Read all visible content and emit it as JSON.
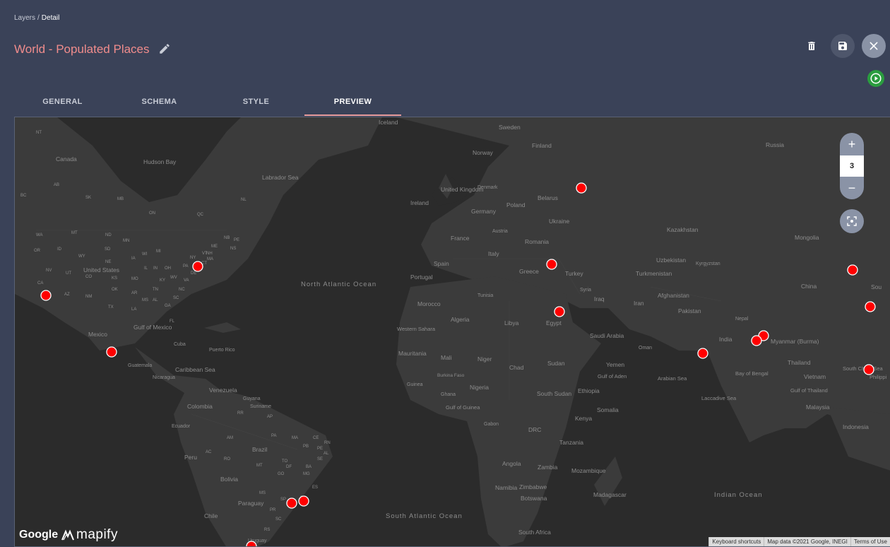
{
  "breadcrumb": {
    "parent": "Layers",
    "separator": "/",
    "current": "Detail"
  },
  "title": "World - Populated Places",
  "tabs": [
    {
      "label": "GENERAL",
      "active": false
    },
    {
      "label": "SCHEMA",
      "active": false
    },
    {
      "label": "STYLE",
      "active": false
    },
    {
      "label": "PREVIEW",
      "active": true
    }
  ],
  "icons": {
    "edit": "pencil-icon",
    "delete": "trash-icon",
    "save": "save-icon",
    "close": "close-icon",
    "run": "play-icon",
    "fit": "fit-bounds-icon"
  },
  "colors": {
    "accent": "#f08c8c",
    "background": "#3a4258",
    "marker": "#ff0000",
    "run": "#2a9d3f",
    "map": "#2b2b2b"
  },
  "map": {
    "zoom_in_label": "+",
    "zoom_level": "3",
    "zoom_out_label": "−",
    "google_logo": "Google",
    "mapify_logo": "mapify",
    "attribution": [
      "Keyboard shortcuts",
      "Map data ©2021 Google, INEGI",
      "Terms of Use"
    ],
    "labels": {
      "iceland": "Iceland",
      "sweden": "Sweden",
      "finland": "Finland",
      "norway": "Norway",
      "russia": "Russia",
      "canada": "Canada",
      "hudson_bay": "Hudson Bay",
      "labrador_sea": "Labrador Sea",
      "united_kingdom": "United Kingdom",
      "denmark": "Denmark",
      "ireland": "Ireland",
      "belarus": "Belarus",
      "germany": "Germany",
      "poland": "Poland",
      "ukraine": "Ukraine",
      "kazakhstan": "Kazakhstan",
      "mongolia": "Mongolia",
      "france": "France",
      "austria": "Austria",
      "romania": "Romania",
      "italy": "Italy",
      "spain": "Spain",
      "portugal": "Portugal",
      "greece": "Greece",
      "turkey": "Turkey",
      "uzbekistan": "Uzbekistan",
      "kyrgyzstan": "Kyrgyzstan",
      "turkmenistan": "Turkmenistan",
      "china": "China",
      "united_states": "United States",
      "north_atlantic_ocean": "North Atlantic Ocean",
      "tunisia": "Tunisia",
      "syria": "Syria",
      "afghanistan": "Afghanistan",
      "iraq": "Iraq",
      "iran": "Iran",
      "morocco": "Morocco",
      "algeria": "Algeria",
      "libya": "Libya",
      "egypt": "Egypt",
      "pakistan": "Pakistan",
      "nepal": "Nepal",
      "gulf_of_mexico": "Gulf of Mexico",
      "mexico": "Mexico",
      "saudi_arabia": "Saudi Arabia",
      "india": "India",
      "myanmar": "Myanmar (Burma)",
      "western_sahara": "Western Sahara",
      "cuba": "Cuba",
      "puerto_rico": "Puerto Rico",
      "oman": "Oman",
      "mauritania": "Mauritania",
      "mali": "Mali",
      "niger": "Niger",
      "guatemala": "Guatemala",
      "caribbean_sea": "Caribbean Sea",
      "chad": "Chad",
      "sudan": "Sudan",
      "yemen": "Yemen",
      "gulf_of_aden": "Gulf of Aden",
      "arabian_sea": "Arabian Sea",
      "bay_of_bengal": "Bay of Bengal",
      "thailand": "Thailand",
      "south_china_sea": "South China Sea",
      "philippines": "Philippi",
      "vietnam": "Vietnam",
      "nicaragua": "Nicaragua",
      "burkina_faso": "Burkina Faso",
      "guinea": "Guinea",
      "ghana": "Ghana",
      "nigeria": "Nigeria",
      "south_sudan": "South Sudan",
      "ethiopia": "Ethiopia",
      "gulf_of_thailand": "Gulf of Thailand",
      "venezuela": "Venezuela",
      "guyana": "Guyana",
      "suriname": "Suriname",
      "laccadive_sea": "Laccadive Sea",
      "colombia": "Colombia",
      "gulf_of_guinea": "Gulf of Guinea",
      "somalia": "Somalia",
      "malaysia": "Malaysia",
      "kenya": "Kenya",
      "gabon": "Gabon",
      "ecuador": "Ecuador",
      "drc": "DRC",
      "indonesia": "Indonesia",
      "brazil": "Brazil",
      "tanzania": "Tanzania",
      "peru": "Peru",
      "angola": "Angola",
      "zambia": "Zambia",
      "mozambique": "Mozambique",
      "bolivia": "Bolivia",
      "namibia": "Namibia",
      "zimbabwe": "Zimbabwe",
      "madagascar": "Madagascar",
      "indian_ocean": "Indian Ocean",
      "botswana": "Botswana",
      "paraguay": "Paraguay",
      "chile": "Chile",
      "south_atlantic_ocean": "South Atlantic Ocean",
      "south_africa": "South Africa",
      "uruguay": "Uruguay",
      "sou": "Sou"
    },
    "state_codes": [
      "NT",
      "AB",
      "SK",
      "BC",
      "MB",
      "ON",
      "QC",
      "NL",
      "WA",
      "MT",
      "ND",
      "MN",
      "OR",
      "ID",
      "WY",
      "SD",
      "NE",
      "IA",
      "NV",
      "UT",
      "CO",
      "KS",
      "CA",
      "AZ",
      "NM",
      "OK",
      "TX",
      "MO",
      "AR",
      "LA",
      "MS",
      "AL",
      "TN",
      "KY",
      "IL",
      "IN",
      "OH",
      "WI",
      "MI",
      "PA",
      "NY",
      "NJ",
      "VA",
      "WV",
      "NC",
      "SC",
      "GA",
      "FL",
      "NB",
      "PE",
      "NS",
      "ME",
      "VT",
      "NH",
      "MA",
      "DE",
      "CT",
      "RR",
      "AP",
      "AM",
      "PA",
      "MA",
      "CE",
      "RN",
      "PB",
      "PE",
      "AL",
      "SE",
      "BA",
      "TO",
      "AC",
      "RO",
      "MT",
      "GO",
      "DF",
      "MG",
      "ES",
      "MS",
      "SP",
      "RJ",
      "PR",
      "SC",
      "RS"
    ]
  }
}
